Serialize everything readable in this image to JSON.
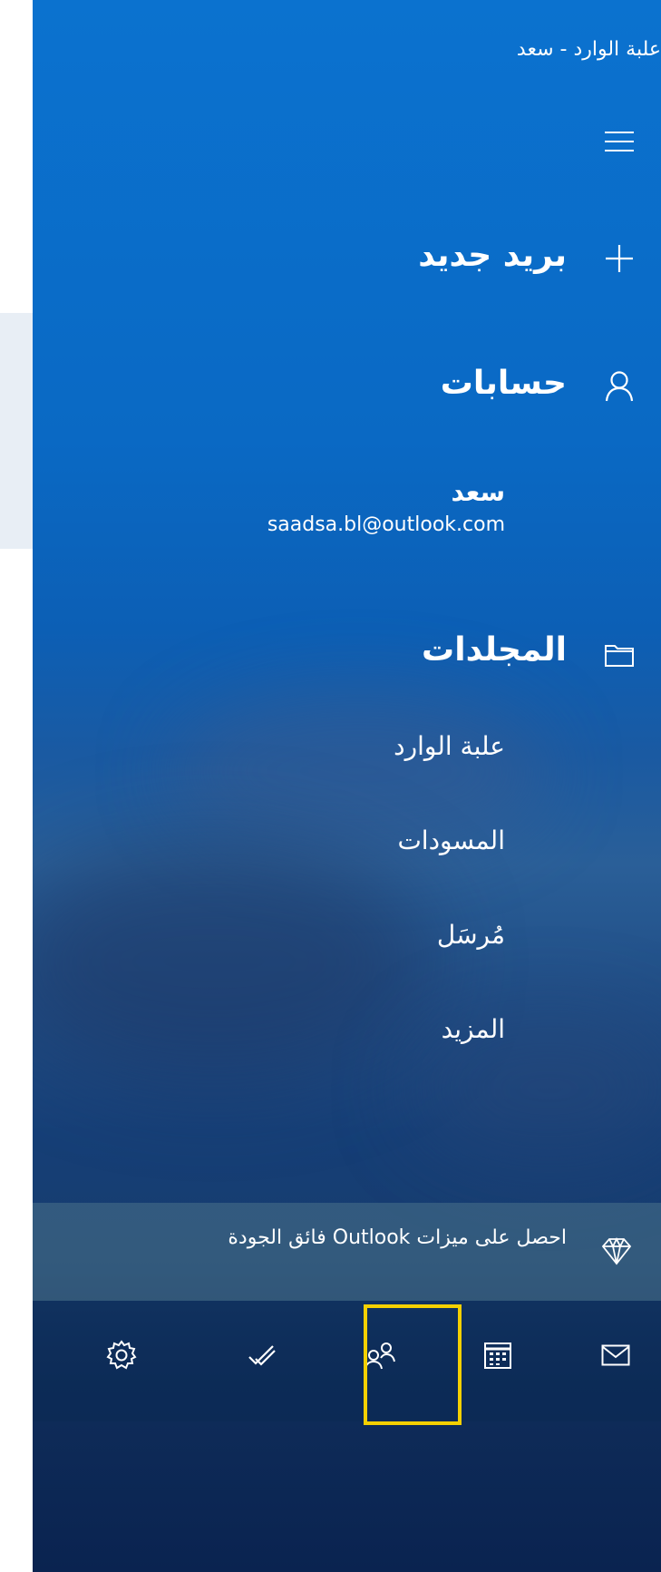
{
  "window": {
    "title": "علبة الوارد - سعد"
  },
  "nav": {
    "new_mail": "بريد جديد",
    "accounts": "حسابات",
    "folders_heading": "المجلدات"
  },
  "account": {
    "name": "سعد",
    "email": "saadsa.bl@outlook.com"
  },
  "folders": [
    "علبة الوارد",
    "المسودات",
    "مُرسَل",
    "المزيد"
  ],
  "premium": {
    "text": "احصل على ميزات Outlook فائق الجودة"
  },
  "bottom_bar": {
    "icons": [
      "mail-icon",
      "calendar-icon",
      "people-icon",
      "todo-icon",
      "settings-icon"
    ],
    "highlighted": "calendar-icon",
    "highlight_color": "#f5d000"
  },
  "colors": {
    "accent": "#0b72cf",
    "text": "#ffffff"
  }
}
